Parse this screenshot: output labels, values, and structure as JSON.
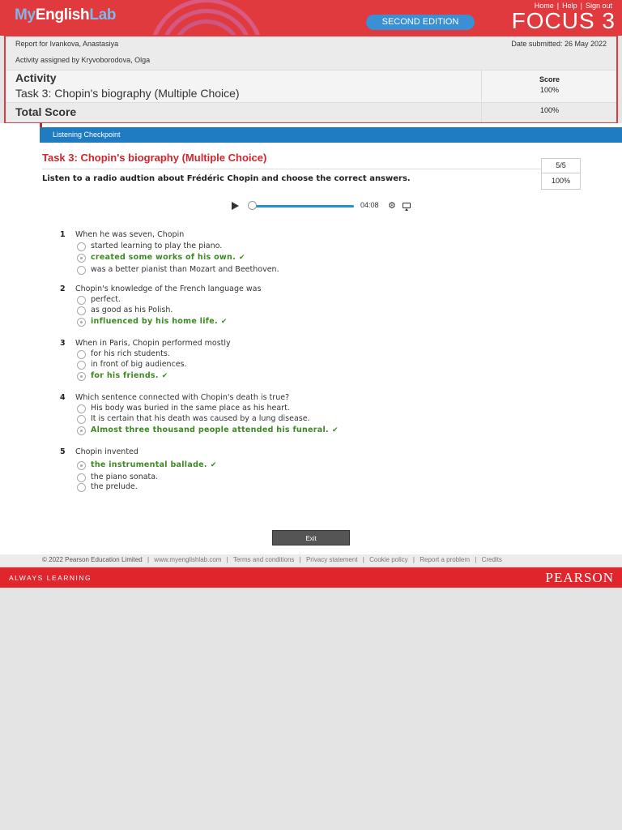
{
  "header": {
    "logo_my": "My",
    "logo_english": "English",
    "logo_lab": "Lab",
    "links": [
      "Home",
      "Help",
      "Sign out"
    ],
    "link_sep": "|",
    "edition": "SECOND EDITION",
    "brand": "FOCUS 3"
  },
  "report": {
    "report_for": "Report for Ivankova, Anastasiya",
    "assigned_by": "Activity assigned by Kryvoborodova, Olga",
    "date_submitted": "Date submitted: 26 May 2022",
    "activity_label": "Activity",
    "activity_name": "Task 3: Chopin's biography (Multiple Choice)",
    "score_header": "Score",
    "activity_score": "100%",
    "total_label": "Total Score",
    "total_score": "100%"
  },
  "section": {
    "bar_label": "Listening Checkpoint",
    "task_title": "Task 3: Chopin's biography (Multiple Choice)",
    "score_fraction": "5/5",
    "score_percent": "100%",
    "instruction": "Listen to a radio audtion about Frédéric Chopin and choose the correct answers."
  },
  "player": {
    "time": "04:08",
    "progress": 0.0
  },
  "questions": [
    {
      "num": "1",
      "text": "When he was seven, Chopin",
      "options": [
        "started learning to play the piano.",
        "created some works of his own.",
        "was a better pianist than Mozart and Beethoven."
      ],
      "selected": 1
    },
    {
      "num": "2",
      "text": "Chopin's knowledge of the French language was",
      "options": [
        "perfect.",
        "as good as his Polish.",
        "influenced by his home life."
      ],
      "selected": 2
    },
    {
      "num": "3",
      "text": "When in Paris, Chopin performed mostly",
      "options": [
        "for his rich students.",
        "in front of big audiences.",
        "for his friends."
      ],
      "selected": 2
    },
    {
      "num": "4",
      "text": "Which sentence connected with Chopin's death is true?",
      "options": [
        "His body was buried in the same place as his heart.",
        "It is certain that his death was caused by a lung disease.",
        "Almost three thousand people attended his funeral."
      ],
      "selected": 2
    },
    {
      "num": "5",
      "text": "Chopin invented",
      "options": [
        "the instrumental ballade.",
        "the piano sonata.",
        "the prelude."
      ],
      "selected": 0
    }
  ],
  "check_mark": "✔",
  "exit_label": "Exit",
  "footer": {
    "copyright": "© 2022 Pearson Education Limited",
    "links": [
      "www.myenglishlab.com",
      "Terms and conditions",
      "Privacy statement",
      "Cookie policy",
      "Report a problem",
      "Credits"
    ],
    "sep": "|"
  },
  "bottom": {
    "tagline": "ALWAYS LEARNING",
    "brand": "PEARSON"
  },
  "colors": {
    "brand_red": "#e0393e",
    "bar_blue": "#1f7bc2",
    "correct_green": "#3c8a22",
    "title_red": "#d0262c"
  },
  "icons": [
    "play-icon",
    "settings-gear-icon",
    "screen-icon",
    "check-icon"
  ]
}
